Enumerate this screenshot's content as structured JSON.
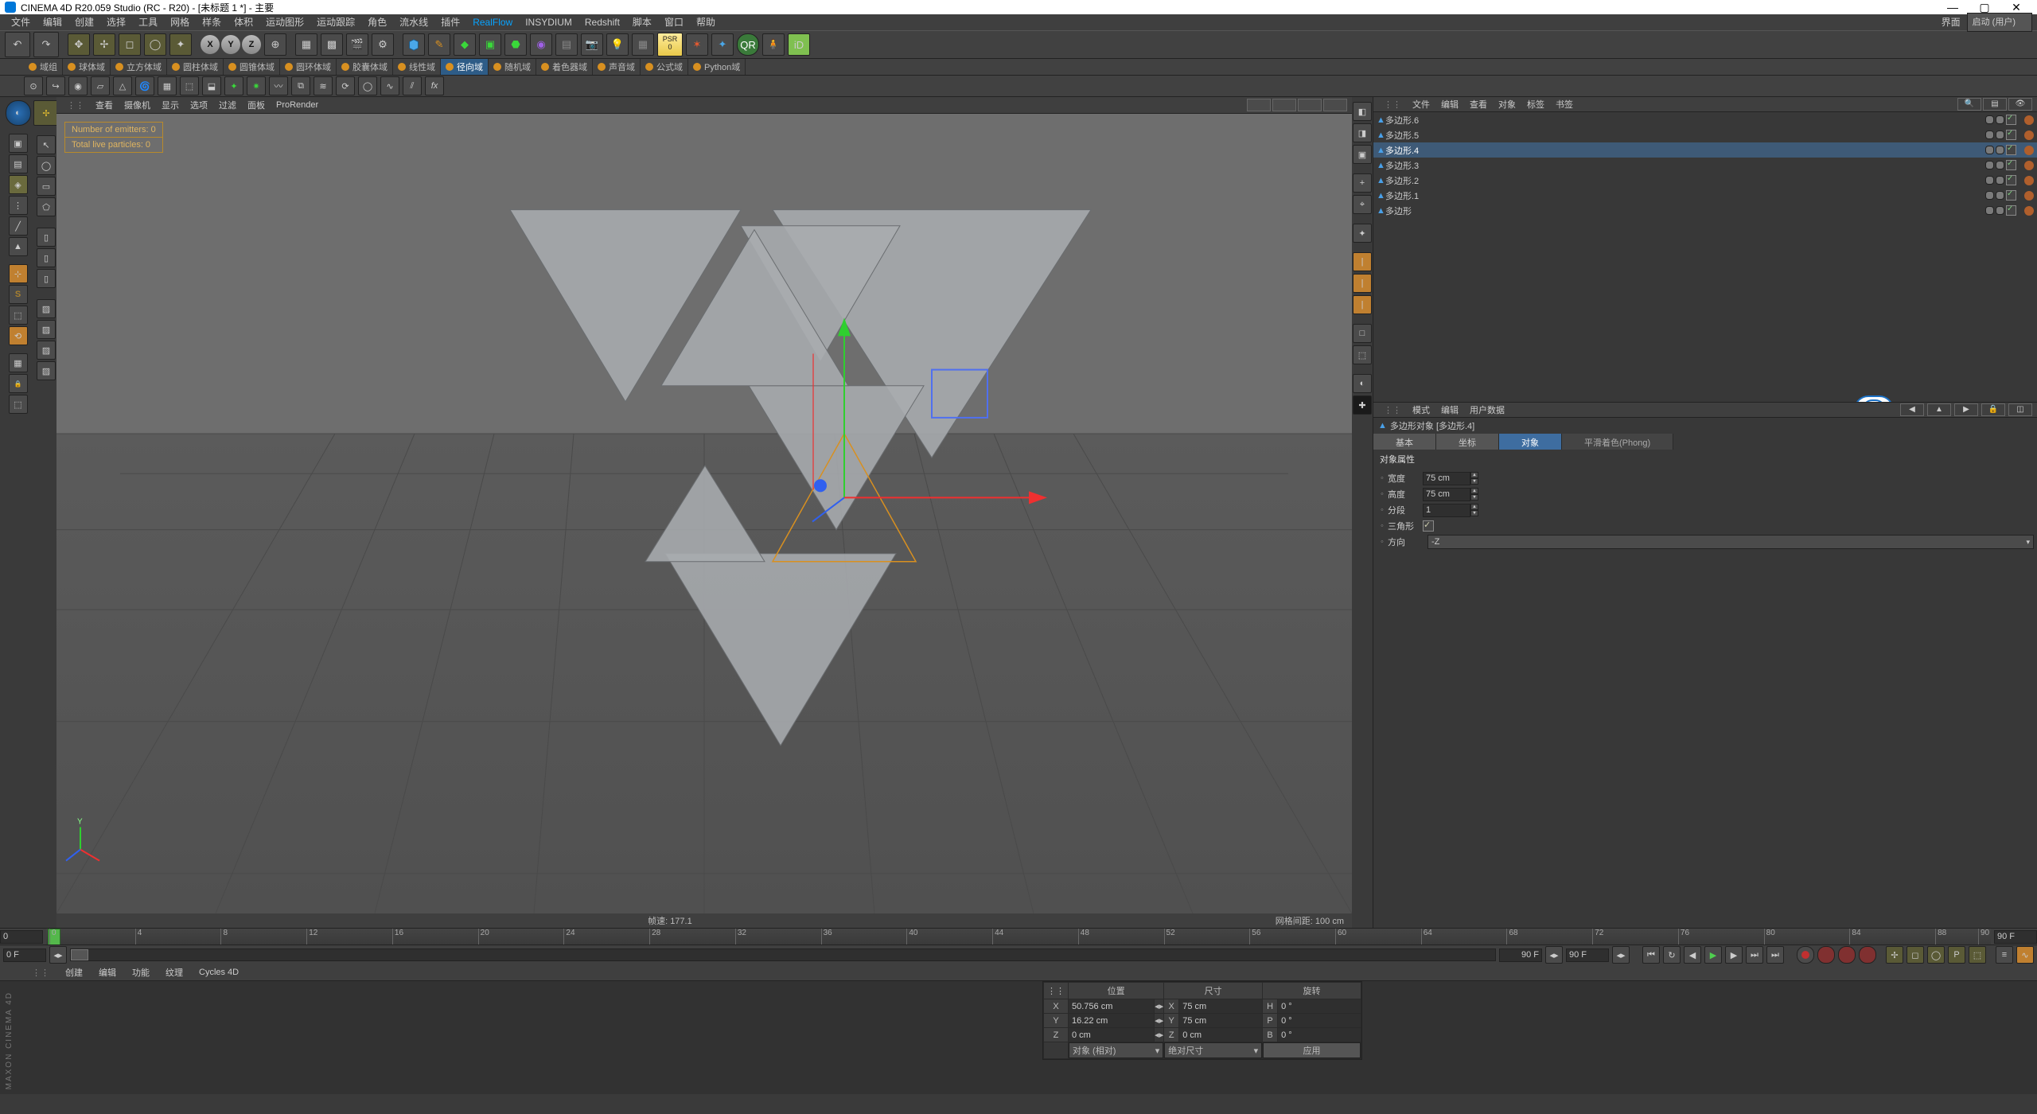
{
  "title": "CINEMA 4D R20.059 Studio (RC - R20) - [未标题 1 *] - 主要",
  "menu": [
    "文件",
    "编辑",
    "创建",
    "选择",
    "工具",
    "网格",
    "样条",
    "体积",
    "运动图形",
    "运动跟踪",
    "角色",
    "流水线",
    "插件",
    "RealFlow",
    "INSYDIUM",
    "Redshift",
    "脚本",
    "窗口",
    "帮助"
  ],
  "layout_label": "界面",
  "layout_value": "启动 (用户)",
  "axes": [
    "X",
    "Y",
    "Z"
  ],
  "psr_label": "PSR",
  "psr_zero": "0",
  "shelf2_items": [
    "域组",
    "球体域",
    "立方体域",
    "圆柱体域",
    "圆锥体域",
    "圆环体域",
    "胶囊体域",
    "线性域",
    "径向域",
    "随机域",
    "着色器域",
    "声音域",
    "公式域",
    "Python域"
  ],
  "viewport_menu": [
    "查看",
    "摄像机",
    "显示",
    "选项",
    "过滤",
    "面板",
    "ProRender"
  ],
  "emitter_info_1": "Number of emitters: 0",
  "emitter_info_2": "Total live particles: 0",
  "vp_status_mid": "帧速: 177.1",
  "vp_status_right": "网格间距: 100 cm",
  "right_tool_icons": [
    "◧",
    "◨",
    "▣",
    "+",
    "⌖",
    "✦",
    "|",
    "|",
    "|",
    "□",
    "⬚",
    "◐",
    "✚"
  ],
  "om": {
    "menu": [
      "文件",
      "编辑",
      "查看",
      "对象",
      "标签",
      "书签"
    ],
    "items": [
      {
        "name": "多边形.6"
      },
      {
        "name": "多边形.5"
      },
      {
        "name": "多边形.4",
        "selected": true
      },
      {
        "name": "多边形.3"
      },
      {
        "name": "多边形.2"
      },
      {
        "name": "多边形.1"
      },
      {
        "name": "多边形"
      }
    ]
  },
  "attr": {
    "menu": [
      "模式",
      "编辑",
      "用户数据"
    ],
    "head": "多边形对象 [多边形.4]",
    "tabs": [
      {
        "label": "基本"
      },
      {
        "label": "坐标"
      },
      {
        "label": "对象",
        "selected": true
      },
      {
        "label": "平滑着色(Phong)",
        "phong": true
      }
    ],
    "section": "对象属性",
    "rows": {
      "width_label": "宽度",
      "width": "75 cm",
      "height_label": "高度",
      "height": "75 cm",
      "segments_label": "分段",
      "segments": "1",
      "triangle_label": "三角形",
      "orient_label": "方向",
      "orient": "-Z"
    }
  },
  "timeline": {
    "start": "0 F",
    "end": "90 F",
    "rangestart": "0",
    "rangeend": "90 F",
    "ticks": [
      0,
      4,
      8,
      12,
      16,
      20,
      24,
      28,
      32,
      36,
      40,
      44,
      48,
      52,
      56,
      60,
      64,
      68,
      72,
      76,
      80,
      84,
      88,
      90
    ]
  },
  "bottom_tabs": [
    "创建",
    "编辑",
    "功能",
    "纹理",
    "Cycles 4D"
  ],
  "coord": {
    "headers": [
      "位置",
      "尺寸",
      "旋转"
    ],
    "axes": [
      "X",
      "Y",
      "Z"
    ],
    "pos": [
      "50.756 cm",
      "16.22 cm",
      "0 cm"
    ],
    "size_labels": [
      "X",
      "Y",
      "Z"
    ],
    "size": [
      "75 cm",
      "75 cm",
      "0 cm"
    ],
    "rot_labels": [
      "H",
      "P",
      "B"
    ],
    "rot": [
      "0 °",
      "0 °",
      "0 °"
    ],
    "mode1": "对象 (相对)",
    "mode2": "绝对尺寸",
    "apply": "应用"
  },
  "maxon": "MAXON CINEMA 4D"
}
